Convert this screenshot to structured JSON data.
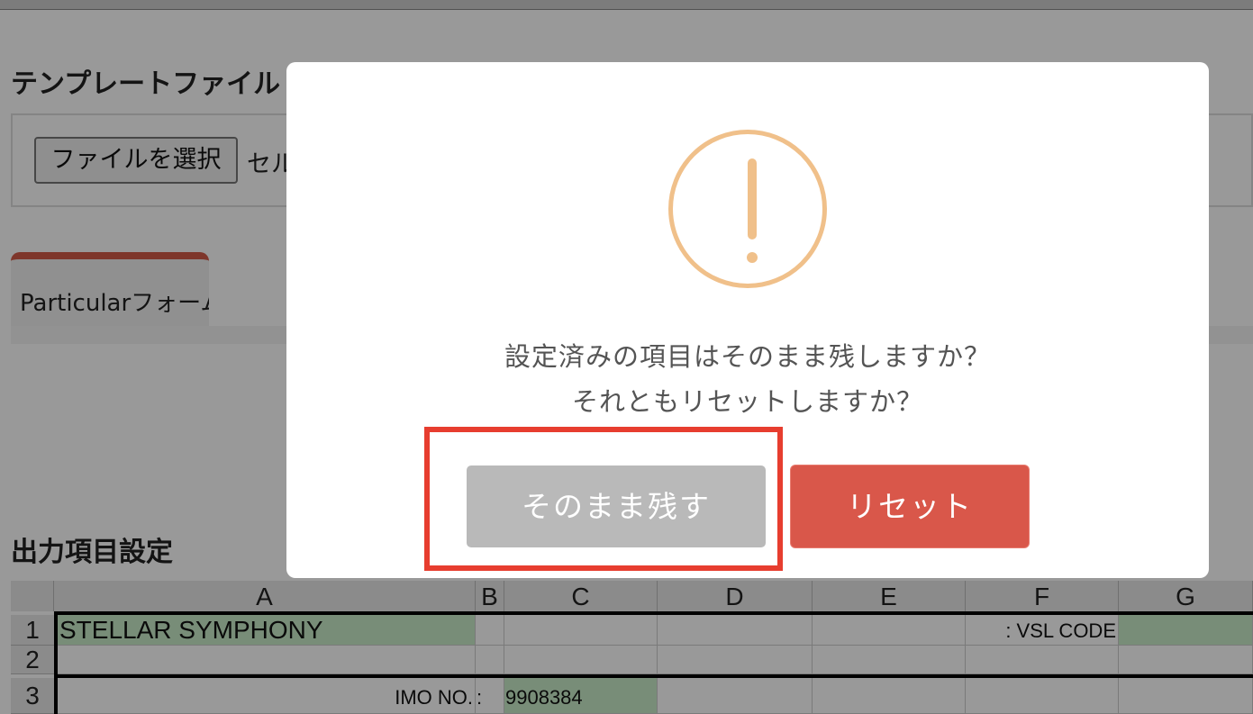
{
  "page": {
    "template_title": "テンプレートファイル",
    "file_button": "ファイルを選択",
    "file_name": "セル",
    "tab_label": "Particularフォーム",
    "output_title": "出力項目設定"
  },
  "sheet": {
    "columns": [
      "A",
      "B",
      "C",
      "D",
      "E",
      "F",
      "G"
    ],
    "rows": [
      "1",
      "2",
      "3"
    ],
    "a1": "STELLAR SYMPHONY",
    "f1": ": VSL CODE",
    "a3": "IMO NO.",
    "b3": ":",
    "c3": "9908384"
  },
  "dialog": {
    "icon": "warning-icon",
    "message_line1": "設定済みの項目はそのまま残しますか？",
    "message_line2": "それともリセットしますか？",
    "keep_button": "そのまま残す",
    "reset_button": "リセット"
  },
  "colors": {
    "accent": "#d9574a",
    "warning": "#f0c08a",
    "highlight": "#e73d2f",
    "cell_green": "#c9ecc9"
  }
}
